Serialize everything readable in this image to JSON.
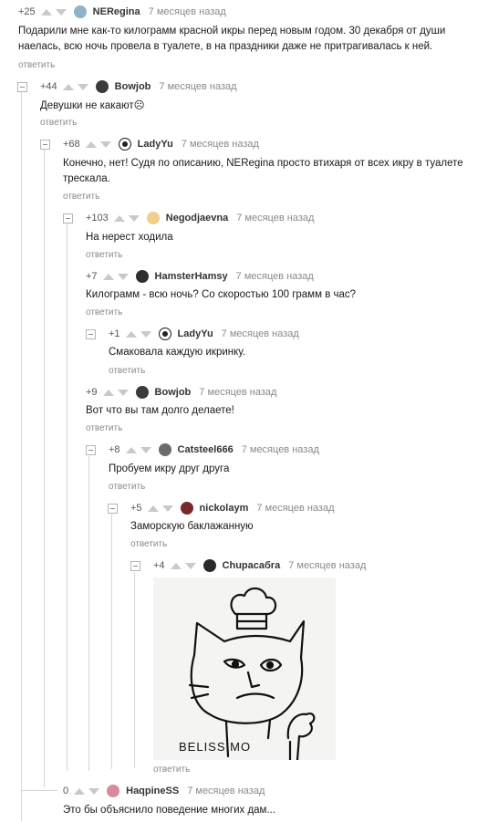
{
  "comments": [
    {
      "rating": "+25",
      "user": "NERegina",
      "time": "7 месяцев назад",
      "text": "Подарили мне как-то килограмм красной икры перед новым годом. 30 декабря от души наелась, всю ночь провела в туалете, в на праздники даже не притрагивалась к ней.",
      "reply": "ответить",
      "avatar_color": "#8fb3c9"
    },
    {
      "rating": "+44",
      "user": "Bowjob",
      "time": "7 месяцев назад",
      "text": "Девушки не какают☹",
      "reply": "ответить",
      "avatar_color": "#3a3a3a"
    },
    {
      "rating": "+68",
      "user": "LadyYu",
      "time": "7 месяцев назад",
      "text": "Конечно, нет! Судя по описанию, NERegina просто втихаря от всех икру в туалете трескала.",
      "reply": "ответить",
      "avatar_color": "#222222"
    },
    {
      "rating": "+103",
      "user": "Negodjaevna",
      "time": "7 месяцев назад",
      "text": "На нерест ходила",
      "reply": "ответить",
      "avatar_color": "#f0d089"
    },
    {
      "rating": "+7",
      "user": "HamsterHamsy",
      "time": "7 месяцев назад",
      "text": "Килограмм - всю ночь? Со скоростью 100 грамм в час?",
      "reply": "ответить",
      "avatar_color": "#2e2e2e"
    },
    {
      "rating": "+1",
      "user": "LadyYu",
      "time": "7 месяцев назад",
      "text": "Смаковала каждую икринку.",
      "reply": "ответить",
      "avatar_color": "#222222"
    },
    {
      "rating": "+9",
      "user": "Bowjob",
      "time": "7 месяцев назад",
      "text": "Вот что вы там долго делаете!",
      "reply": "ответить",
      "avatar_color": "#3a3a3a"
    },
    {
      "rating": "+8",
      "user": "Catsteel666",
      "time": "7 месяцев назад",
      "text": "Пробуем икру друг друга",
      "reply": "ответить",
      "avatar_color": "#6b6b6b"
    },
    {
      "rating": "+5",
      "user": "nickolaym",
      "time": "7 месяцев назад",
      "text": "Заморскую баклажанную",
      "reply": "ответить",
      "avatar_color": "#7a2a2a"
    },
    {
      "rating": "+4",
      "user": "Chupacaбra",
      "time": "7 месяцев назад",
      "text": "",
      "reply": "ответить",
      "avatar_color": "#2a2a2a",
      "image_caption": "BELISSIMO"
    },
    {
      "rating": "0",
      "user": "HaqpineSS",
      "time": "7 месяцев назад",
      "text": "Это бы объяснило поведение многих дам...",
      "reply": "",
      "avatar_color": "#d98a9a"
    }
  ]
}
